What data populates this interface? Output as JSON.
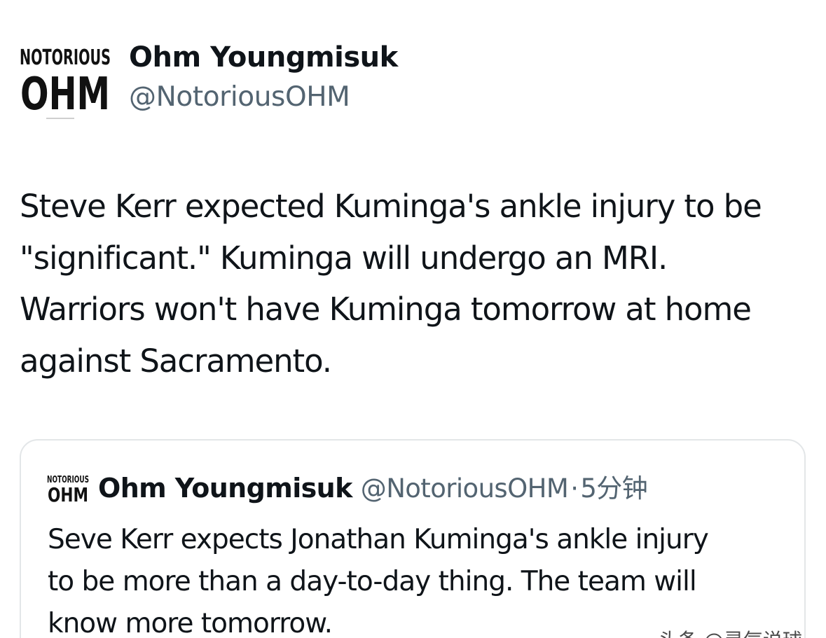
{
  "tweet": {
    "author": {
      "name": "Ohm Youngmisuk",
      "handle": "@NotoriousOHM",
      "avatar_logo_top": "NOTORIOUS",
      "avatar_logo_bottom": "OHM"
    },
    "text_lines": [
      "Steve Kerr expected Kuminga's ankle injury to be",
      "\"significant.\" Kuminga will undergo an MRI.",
      "Warriors won't have Kuminga tomorrow at home",
      "against Sacramento."
    ],
    "quoted": {
      "author_name": "Ohm Youngmisuk",
      "author_handle": "@NotoriousOHM",
      "separator": "·",
      "time": "5分钟",
      "text_lines": [
        "Seve Kerr expects Jonathan Kuminga's ankle injury",
        "to be more than a day-to-day thing. The team will",
        "know more tomorrow."
      ]
    }
  },
  "watermark": "头条 @灵气说球",
  "colors": {
    "text": "#0f1419",
    "secondary": "#536471",
    "border": "#e3e6e8",
    "background": "#ffffff"
  }
}
